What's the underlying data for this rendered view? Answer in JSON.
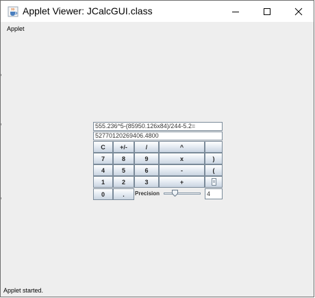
{
  "window": {
    "title": "Applet Viewer: JCalcGUI.class",
    "icons": {
      "app": "java-cup-icon",
      "minimize": "minimize-icon",
      "maximize": "maximize-icon",
      "close": "close-icon"
    }
  },
  "menu": {
    "items": [
      "Applet"
    ]
  },
  "calculator": {
    "expression": "555.236^5-(85950.126x84)/244-5.2=",
    "result": "52770120269406.4800",
    "rows": [
      [
        "C",
        "+/-",
        "/",
        "^",
        ""
      ],
      [
        "7",
        "8",
        "9",
        "x",
        ")"
      ],
      [
        "4",
        "5",
        "6",
        "-",
        "("
      ],
      [
        "1",
        "2",
        "3",
        "+",
        ""
      ],
      [
        "0",
        "."
      ]
    ],
    "precision_label": "Precision",
    "precision_value": "4"
  },
  "status": {
    "text": "Applet started."
  },
  "colors": {
    "window_bg": "#eeeeee",
    "titlebar_bg": "#ffffff",
    "button_border": "#7a8a99"
  }
}
